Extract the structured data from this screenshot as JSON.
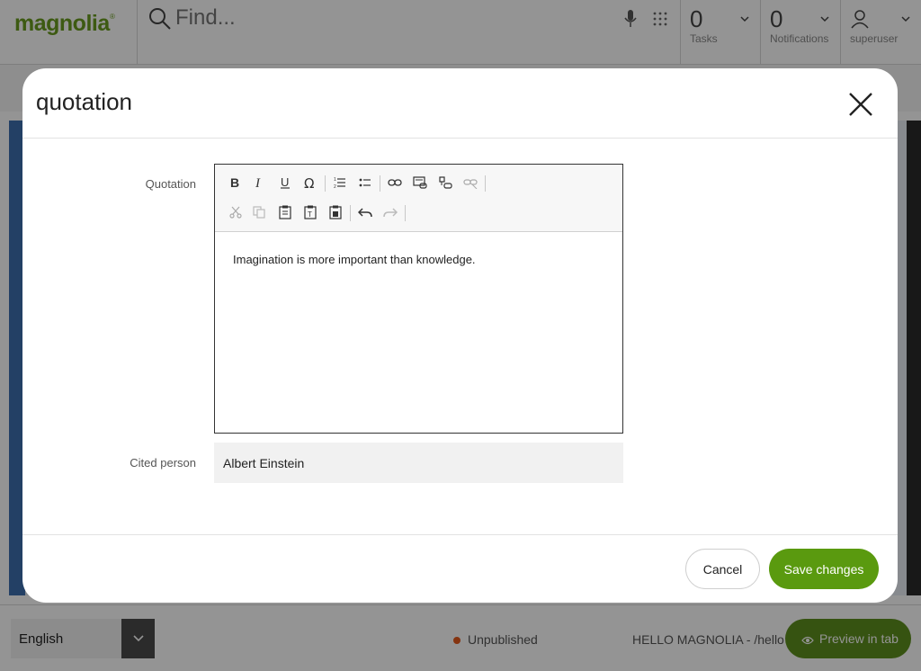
{
  "app": {
    "logo_text": "magnolia",
    "logo_mark": "®",
    "search": {
      "placeholder": "Find..."
    },
    "tasks": {
      "count": "0",
      "label": "Tasks"
    },
    "notifications": {
      "count": "0",
      "label": "Notifications"
    },
    "user": {
      "label": "superuser"
    }
  },
  "bottombar": {
    "language": "English",
    "status": "Unpublished",
    "status_color": "#e55a1c",
    "page_path": "HELLO MAGNOLIA - /hello",
    "preview_label": "Preview in tab"
  },
  "dialog": {
    "title": "quotation",
    "fields": {
      "quotation": {
        "label": "Quotation",
        "value": "Imagination is more important than knowledge.",
        "toolbar_row1": [
          "bold-icon",
          "italic-icon",
          "underline-icon",
          "special-char-icon",
          "numbered-list-icon",
          "bulleted-list-icon",
          "link-icon",
          "internal-link-icon",
          "asset-link-icon",
          "unlink-icon"
        ],
        "toolbar_row2": [
          "cut-icon",
          "copy-icon",
          "paste-icon",
          "paste-text-icon",
          "paste-word-icon",
          "undo-icon",
          "redo-icon"
        ]
      },
      "cited_person": {
        "label": "Cited person",
        "value": "Albert Einstein"
      }
    },
    "cancel_label": "Cancel",
    "save_label": "Save changes"
  },
  "colors": {
    "accent": "#5a9a0f",
    "brand": "#6a9c1f",
    "overlay": "rgba(0,0,0,0.42)"
  }
}
